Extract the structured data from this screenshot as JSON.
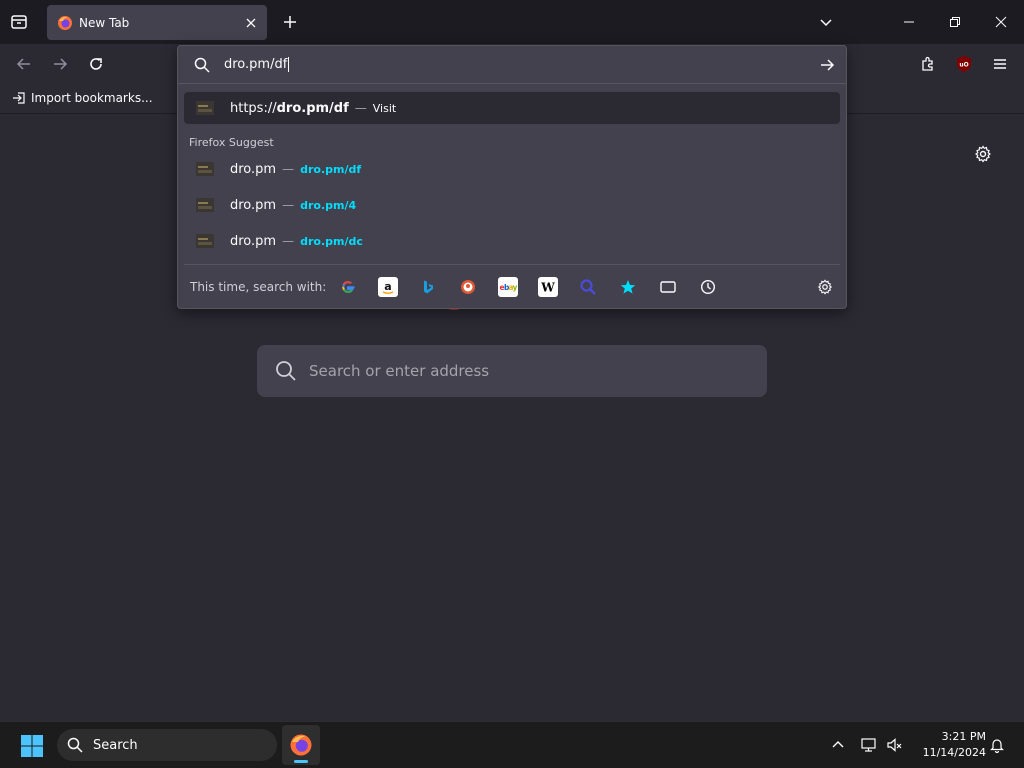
{
  "tabbar": {
    "tab_title": "New Tab"
  },
  "bookmarks": {
    "import_label": "Import bookmarks..."
  },
  "urlbar": {
    "value": "dro.pm/df",
    "heuristic": {
      "prefix": "https://",
      "bold": "dro.pm/df",
      "sep": "—",
      "action": "Visit"
    },
    "group_label": "Firefox Suggest",
    "suggestions": [
      {
        "title": "dro.pm",
        "sep": "—",
        "url": "dro.pm/df"
      },
      {
        "title": "dro.pm",
        "sep": "—",
        "url": "dro.pm/4"
      },
      {
        "title": "dro.pm",
        "sep": "—",
        "url": "dro.pm/dc"
      }
    ],
    "one_off_label": "This time, search with:",
    "engines": [
      "google-icon",
      "amazon-icon",
      "bing-icon",
      "duckduckgo-icon",
      "ebay-icon",
      "wikipedia-icon",
      "search-engine-icon",
      "bookmarks-icon",
      "tabs-icon",
      "history-icon"
    ]
  },
  "content": {
    "search_placeholder": "Search or enter address"
  },
  "taskbar": {
    "search_label": "Search",
    "time": "3:21 PM",
    "date": "11/14/2024"
  },
  "colors": {
    "accent_link": "#00ddff",
    "chrome_bg": "#1c1b22",
    "content_bg": "#2b2a33",
    "popup_bg": "#42414d"
  }
}
